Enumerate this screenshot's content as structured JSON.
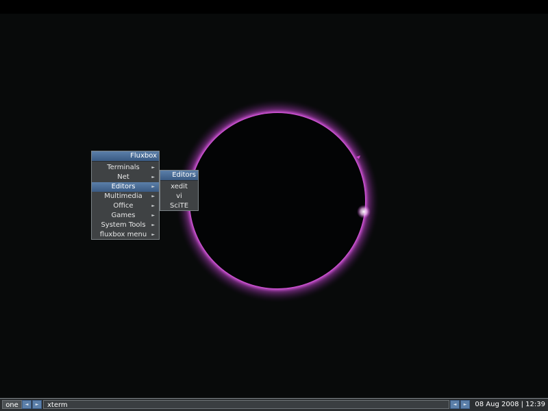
{
  "desktop": {
    "wallpaper_description_name": "solar-eclipse-wallpaper",
    "colors": {
      "background": "#080a0a",
      "corona": "#d04ad8",
      "highlight": "#5b7fa9"
    }
  },
  "root_menu": {
    "title": "Fluxbox",
    "items": [
      {
        "label": "Terminals",
        "submenu": true,
        "highlighted": false
      },
      {
        "label": "Net",
        "submenu": true,
        "highlighted": false
      },
      {
        "label": "Editors",
        "submenu": true,
        "highlighted": true
      },
      {
        "label": "Multimedia",
        "submenu": true,
        "highlighted": false
      },
      {
        "label": "Office",
        "submenu": true,
        "highlighted": false
      },
      {
        "label": "Games",
        "submenu": true,
        "highlighted": false
      },
      {
        "label": "System Tools",
        "submenu": true,
        "highlighted": false
      },
      {
        "label": "fluxbox menu",
        "submenu": true,
        "highlighted": false
      }
    ],
    "arrow_glyph": "►"
  },
  "editors_menu": {
    "title": "Editors",
    "items": [
      {
        "label": "xedit"
      },
      {
        "label": "vi"
      },
      {
        "label": "SciTE"
      }
    ]
  },
  "toolbar": {
    "workspace_name": "one",
    "prev_glyph": "◄",
    "next_glyph": "►",
    "window_title": "xterm",
    "clock": "08 Aug 2008 | 12:39"
  }
}
